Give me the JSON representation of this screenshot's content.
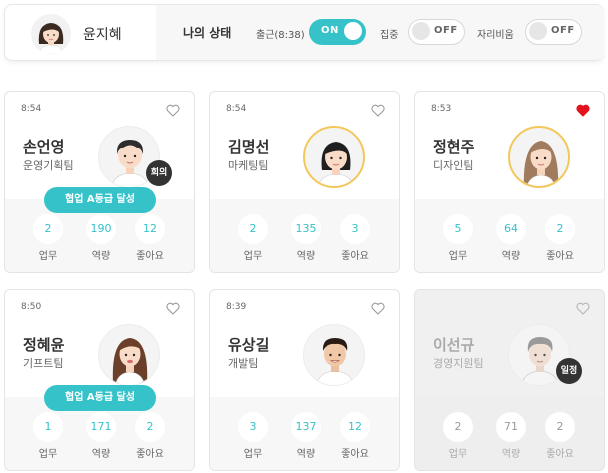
{
  "me": {
    "name": "윤지혜"
  },
  "status": {
    "title": "나의 상태",
    "toggles": [
      {
        "label": "출근(8:38)",
        "state": "ON"
      },
      {
        "label": "집중",
        "state": "OFF"
      },
      {
        "label": "자리비움",
        "state": "OFF"
      }
    ]
  },
  "stat_labels": [
    "업무",
    "역량",
    "좋아요"
  ],
  "colors": {
    "accent": "#36c2c9",
    "liked": "#e3121d",
    "badge": "#333333"
  },
  "cards": [
    {
      "time": "8:54",
      "name": "손언영",
      "team": "운영기획팀",
      "liked": false,
      "badge": "회의",
      "achievement": "협업 A등급 달성",
      "stats": [
        "2",
        "190",
        "12"
      ],
      "dim": false
    },
    {
      "time": "8:54",
      "name": "김명선",
      "team": "마케팅팀",
      "liked": false,
      "badge": "",
      "achievement": "",
      "stats": [
        "2",
        "135",
        "3"
      ],
      "dim": false
    },
    {
      "time": "8:53",
      "name": "정현주",
      "team": "디자인팀",
      "liked": true,
      "badge": "",
      "achievement": "",
      "stats": [
        "5",
        "64",
        "2"
      ],
      "dim": false
    },
    {
      "time": "8:50",
      "name": "정혜윤",
      "team": "기프트팀",
      "liked": false,
      "badge": "",
      "achievement": "협업 A등급 달성",
      "stats": [
        "1",
        "171",
        "2"
      ],
      "dim": false
    },
    {
      "time": "8:39",
      "name": "유상길",
      "team": "개발팀",
      "liked": false,
      "badge": "",
      "achievement": "",
      "stats": [
        "3",
        "137",
        "12"
      ],
      "dim": false
    },
    {
      "time": "",
      "name": "이선규",
      "team": "경영지원팀",
      "liked": false,
      "badge": "일정",
      "achievement": "",
      "stats": [
        "2",
        "71",
        "2"
      ],
      "dim": true
    }
  ]
}
